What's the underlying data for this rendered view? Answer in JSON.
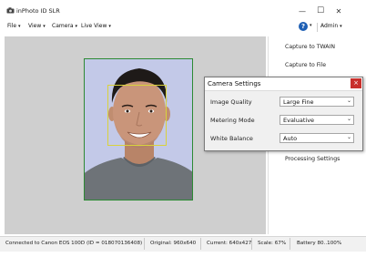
{
  "window": {
    "title": "inPhoto ID SLR",
    "buttons": {
      "minimize": "—",
      "maximize": "☐",
      "close": "✕"
    }
  },
  "menubar": {
    "items": [
      {
        "label": "File"
      },
      {
        "label": "View"
      },
      {
        "label": "Camera"
      },
      {
        "label": "Live View"
      }
    ],
    "help": "?",
    "admin": "Admin"
  },
  "sidepanel": {
    "items": [
      {
        "label": "Capture to TWAIN"
      },
      {
        "label": "Capture to File"
      },
      {
        "label": "Processing Settings"
      }
    ]
  },
  "dialog": {
    "title": "Camera Settings",
    "close": "×",
    "fields": [
      {
        "label": "Image Quality",
        "value": "Large Fine"
      },
      {
        "label": "Metering Mode",
        "value": "Evaluative"
      },
      {
        "label": "White Balance",
        "value": "Auto"
      }
    ]
  },
  "statusbar": {
    "connection": "Connected to Canon EOS 100D (ID = 018070136408)",
    "original": "Original: 960x640",
    "current": "Current: 640x427",
    "scale": "Scale: 67%",
    "battery": "Battery 80..100%"
  },
  "colors": {
    "crop_frame": "#2d8a34",
    "face_frame": "#d9d23c",
    "dialog_close": "#c9302c",
    "help_icon": "#1e5fb4"
  }
}
